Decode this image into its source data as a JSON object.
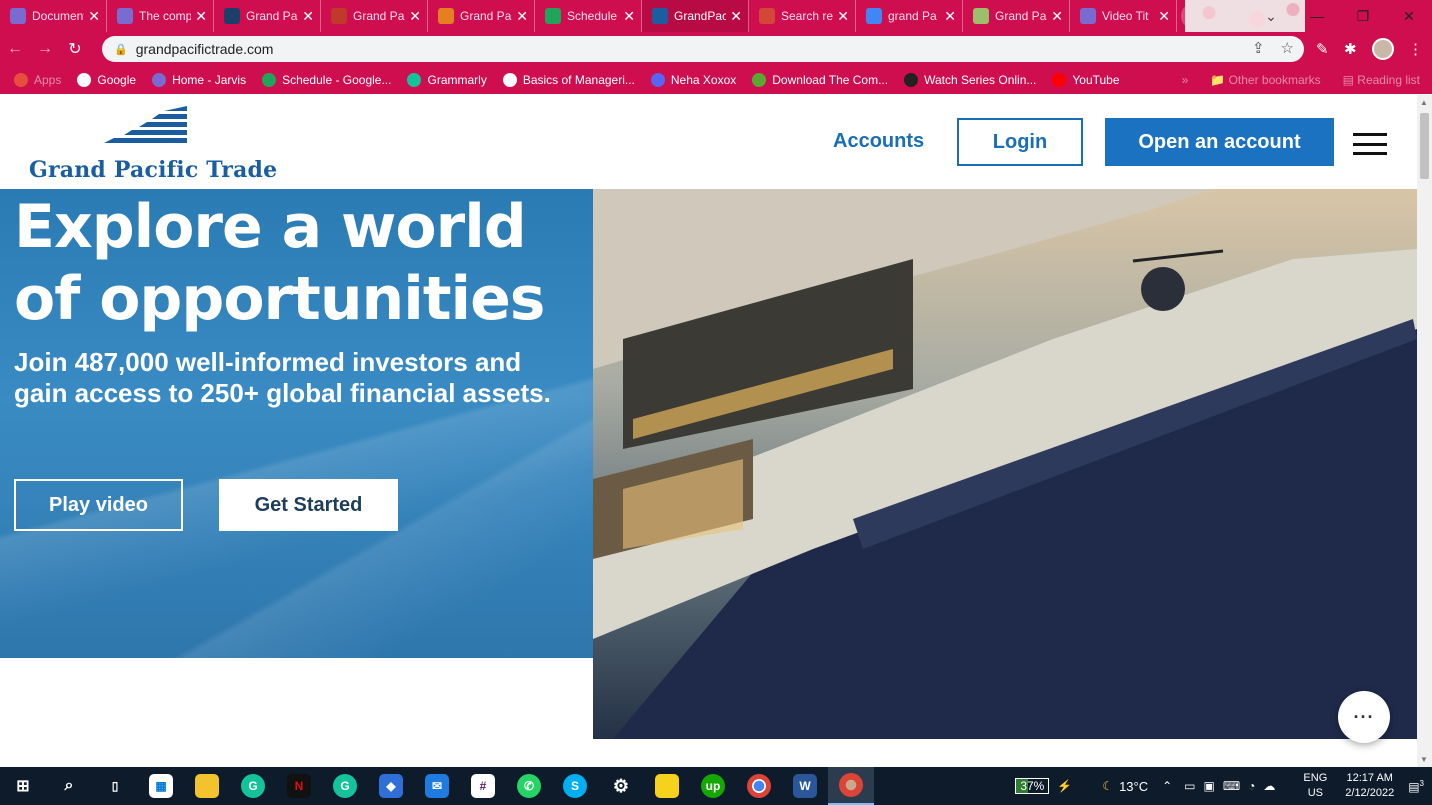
{
  "browser": {
    "tabs": [
      {
        "title": "Document",
        "color": "#7a6bd3"
      },
      {
        "title": "The comp",
        "color": "#7a6bd3"
      },
      {
        "title": "Grand Pa",
        "color": "#1c3f6b"
      },
      {
        "title": "Grand Pa",
        "color": "#c0392b"
      },
      {
        "title": "Grand Pa",
        "color": "#e67e22"
      },
      {
        "title": "Schedule",
        "color": "#22a35a"
      },
      {
        "title": "GrandPac",
        "color": "#1a5ea1"
      },
      {
        "title": "Search re",
        "color": "#d44638"
      },
      {
        "title": "grand Pa",
        "color": "#4285f4"
      },
      {
        "title": "Grand Pa",
        "color": "#9bbf6a"
      },
      {
        "title": "Video Tit",
        "color": "#7a6bd3"
      }
    ],
    "active_tab": 6,
    "new_tab": "+",
    "url": "grandpacifictrade.com",
    "bookmarks": [
      {
        "label": "Apps",
        "color": "#e84d3d",
        "dim": true
      },
      {
        "label": "Google",
        "color": "#ffffff"
      },
      {
        "label": "Home - Jarvis",
        "color": "#7a6bd3"
      },
      {
        "label": "Schedule - Google...",
        "color": "#22a35a"
      },
      {
        "label": "Grammarly",
        "color": "#15c39a"
      },
      {
        "label": "Basics of Manageri...",
        "color": "#ffffff"
      },
      {
        "label": "Neha Xoxox",
        "color": "#5865f2"
      },
      {
        "label": "Download The Com...",
        "color": "#5aa832"
      },
      {
        "label": "Watch Series Onlin...",
        "color": "#222"
      },
      {
        "label": "YouTube",
        "color": "#ff0000"
      }
    ],
    "bookmarks_overflow": "»",
    "other_bookmarks": "Other bookmarks",
    "reading_list": "Reading list"
  },
  "site": {
    "brand": "Grand Pacific Trade",
    "nav": {
      "accounts": "Accounts",
      "login": "Login",
      "open_account": "Open an account"
    },
    "hero": {
      "headline": "Explore a world of opportunities",
      "subheadline": "Join 487,000 well-informed investors and gain access to 250+ global financial assets.",
      "play_video": "Play video",
      "get_started": "Get Started"
    },
    "chat": "···"
  },
  "taskbar": {
    "battery": "37%",
    "weather": "13°C",
    "lang_top": "ENG",
    "lang_bottom": "US",
    "time": "12:17 AM",
    "date": "2/12/2022",
    "notifications": "3"
  },
  "colors": {
    "brand_blue": "#1a72c0",
    "chrome_pink": "#ce0e4f"
  }
}
